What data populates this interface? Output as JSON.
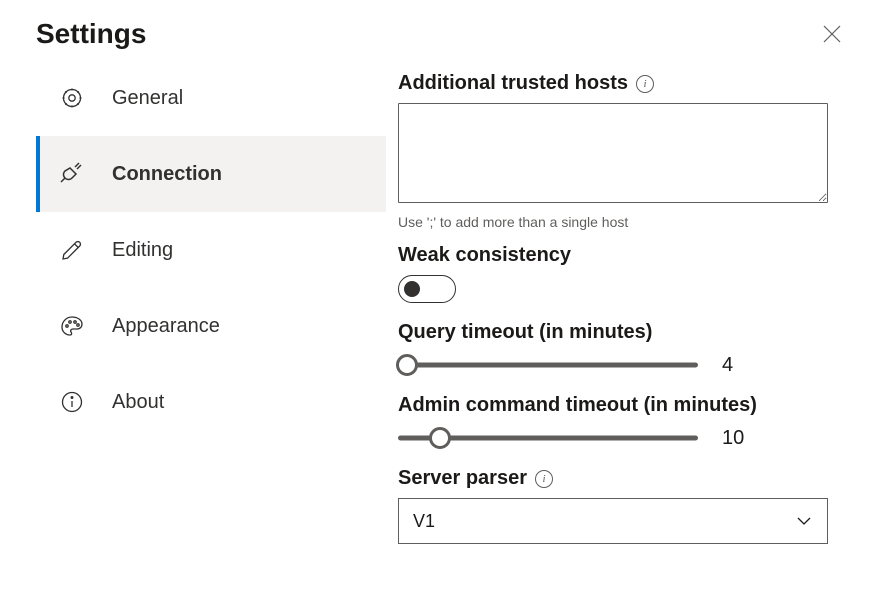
{
  "title": "Settings",
  "sidebar": {
    "items": [
      {
        "label": "General"
      },
      {
        "label": "Connection"
      },
      {
        "label": "Editing"
      },
      {
        "label": "Appearance"
      },
      {
        "label": "About"
      }
    ],
    "activeIndex": 1
  },
  "content": {
    "trustedHosts": {
      "label": "Additional trusted hosts",
      "value": "",
      "hint": "Use ';' to add more than a single host"
    },
    "weakConsistency": {
      "label": "Weak consistency",
      "enabled": false
    },
    "queryTimeout": {
      "label": "Query timeout (in minutes)",
      "value": "4",
      "percent": 3
    },
    "adminTimeout": {
      "label": "Admin command timeout (in minutes)",
      "value": "10",
      "percent": 14
    },
    "serverParser": {
      "label": "Server parser",
      "selected": "V1"
    }
  }
}
